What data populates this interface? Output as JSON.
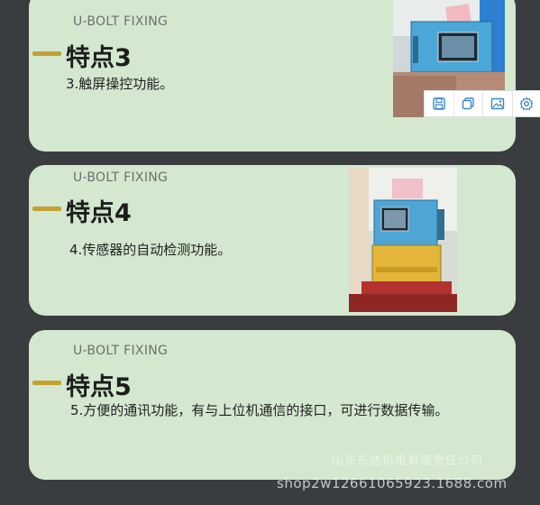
{
  "cards": [
    {
      "tag": "U-BOLT FIXING",
      "title": "特点3",
      "description": "3.触屏操控功能。"
    },
    {
      "tag": "U-BOLT FIXING",
      "title": "特点4",
      "description": "4.传感器的自动检测功能。"
    },
    {
      "tag": "U-BOLT FIXING",
      "title": "特点5",
      "description": "5.方便的通讯功能，有与上位机通信的接口，可进行数据传输。"
    }
  ],
  "image_toolbar": {
    "icons": [
      "save-icon",
      "copy-icon",
      "image-icon",
      "settings-icon"
    ]
  },
  "watermark": {
    "company": "山东东达机电有限责任公司",
    "url": "shop2w12661065923.1688.com"
  },
  "colors": {
    "background": "#3a3d3f",
    "card": "#d3e8cf",
    "accent_dash": "#c4a032"
  }
}
